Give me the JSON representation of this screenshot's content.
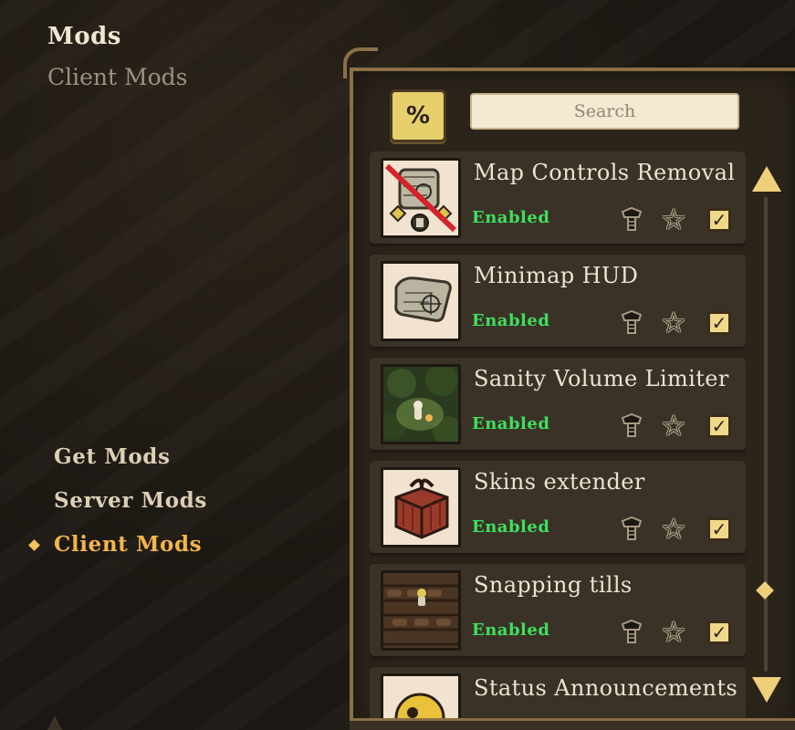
{
  "header": {
    "title": "Mods",
    "subtitle": "Client Mods"
  },
  "nav": {
    "items": [
      {
        "label": "Get Mods",
        "selected": false
      },
      {
        "label": "Server Mods",
        "selected": false
      },
      {
        "label": "Client Mods",
        "selected": true
      }
    ]
  },
  "toolbar": {
    "filter_icon": "percent-filter-icon",
    "filter_glyph": "%",
    "search_placeholder": "Search"
  },
  "mods": [
    {
      "name": "Map Controls Removal",
      "status": "Enabled",
      "thumbnail": "map-scroll-crossed-icon"
    },
    {
      "name": "Minimap HUD",
      "status": "Enabled",
      "thumbnail": "map-scroll-icon"
    },
    {
      "name": "Sanity Volume Limiter",
      "status": "Enabled",
      "thumbnail": "forest-campfire-scene"
    },
    {
      "name": "Skins extender",
      "status": "Enabled",
      "thumbnail": "red-gift-box-icon"
    },
    {
      "name": "Snapping tills",
      "status": "Enabled",
      "thumbnail": "tilled-farm-scene"
    },
    {
      "name": "Status Announcements",
      "status": "",
      "thumbnail": "yellow-face-icon"
    }
  ],
  "item_actions": {
    "config_icon": "bolt-config-icon",
    "favorite_icon": "star-icon",
    "favorite_glyph": "☆",
    "enabled_icon": "checkbox-checked-icon",
    "enabled_glyph": "✓"
  },
  "colors": {
    "status_enabled": "#3ee05e",
    "selected_nav": "#f2b548",
    "panel_border": "#8b6f45",
    "accent_gold": "#f0cf7a"
  }
}
